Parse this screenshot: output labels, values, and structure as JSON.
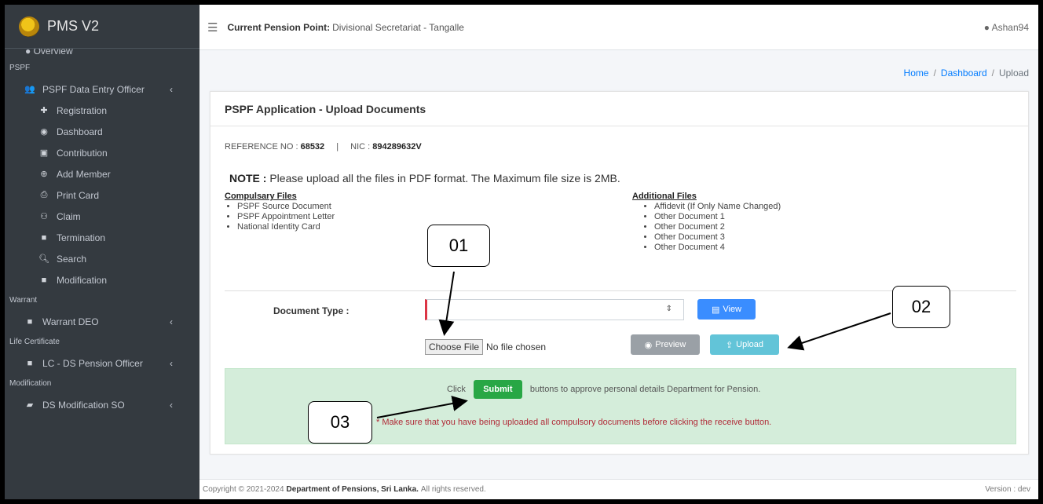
{
  "app": {
    "name": "PMS V2",
    "logo_icon": "emblem-logo-icon"
  },
  "topbar": {
    "pension_point_label": "Current Pension Point:",
    "pension_point_value": "Divisional Secretariat - Tangalle",
    "user": "Ashan94"
  },
  "sidebar": {
    "partial_item": "Overview",
    "sections": [
      {
        "title": "PSPF"
      },
      {
        "title": "Warrant"
      },
      {
        "title": "Life Certificate"
      },
      {
        "title": "Modification"
      }
    ],
    "psfp_group": "PSPF Data Entry Officer",
    "psfp_items": [
      "Registration",
      "Dashboard",
      "Contribution",
      "Add Member",
      "Print Card",
      "Claim",
      "Termination",
      "Search",
      "Modification"
    ],
    "warrant_item": "Warrant DEO",
    "lc_item": "LC - DS Pension Officer",
    "mod_item": "DS Modification SO"
  },
  "breadcrumb": {
    "home": "Home",
    "dashboard": "Dashboard",
    "current": "Upload"
  },
  "card": {
    "title": "PSPF Application - Upload Documents",
    "ref_label": "REFERENCE NO :",
    "ref_value": "68532",
    "nic_label": "NIC :",
    "nic_value": "894289632V",
    "note_label": "NOTE :",
    "note_text": "Please upload all the files in PDF format. The Maximum file size is 2MB.",
    "compulsory_title": "Compulsary Files",
    "compulsory": [
      "PSPF Source Document",
      "PSPF Appointment Letter",
      "National Identity Card"
    ],
    "additional_title": "Additional Files",
    "additional": [
      "Affidevit (If Only Name Changed)",
      "Other Document 1",
      "Other Document 2",
      "Other Document 3",
      "Other Document 4"
    ],
    "doctype_label": "Document Type :",
    "view_label": "View",
    "choose_file_label": "Choose File",
    "no_file_text": "No file chosen",
    "preview_label": "Preview",
    "upload_label": "Upload",
    "alert_click": "Click",
    "submit_label": "Submit",
    "alert_after": "buttons to approve personal details Department for Pension.",
    "alert_warning": "* Make sure that you have being uploaded all compulsory documents before clicking the receive button."
  },
  "footer": {
    "copyright": "Copyright © 2021-2024",
    "org": "Department of Pensions, Sri Lanka.",
    "rights": "All rights reserved.",
    "version": "Version : dev"
  },
  "callouts": {
    "c1": "01",
    "c2": "02",
    "c3": "03"
  },
  "colors": {
    "sidebar": "#343a40",
    "primary": "#007bff",
    "success": "#28a745",
    "danger": "#dc3545",
    "info": "#62c4d8"
  }
}
